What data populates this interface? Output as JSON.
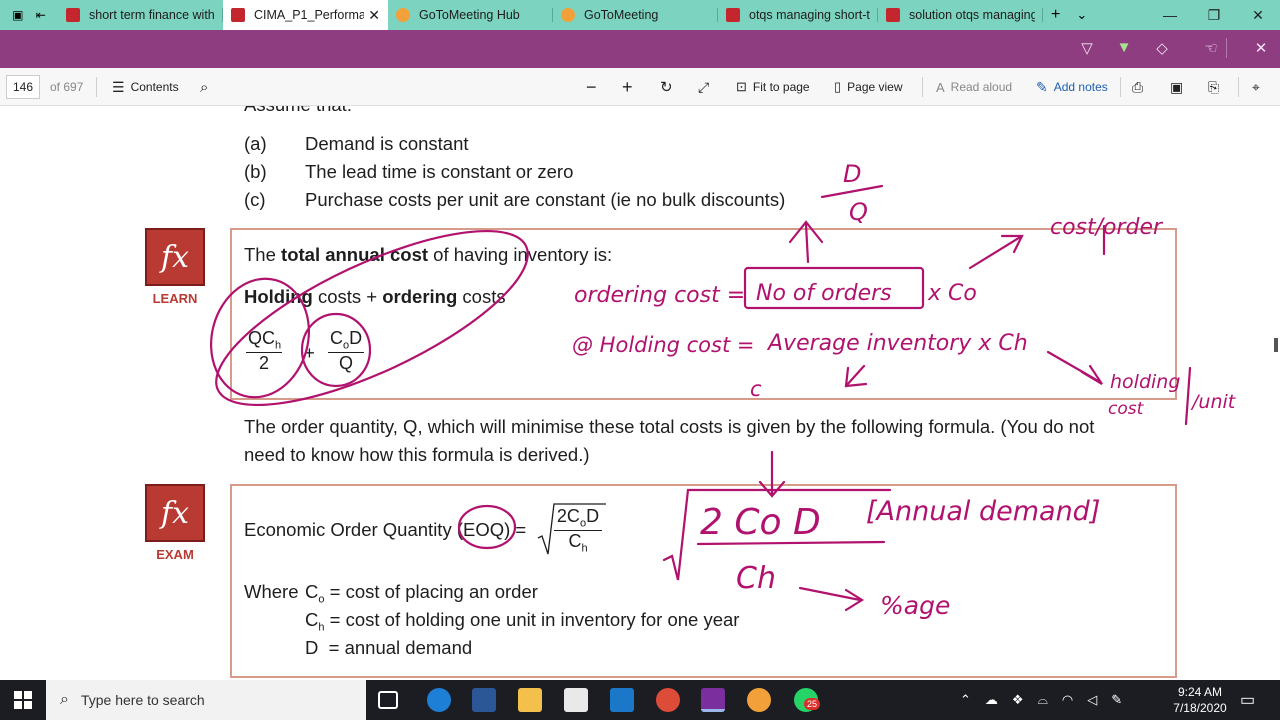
{
  "browser": {
    "tabs": [
      {
        "label": "short term finance with",
        "icon": "pdf-icon",
        "active": false
      },
      {
        "label": "CIMA_P1_Performa",
        "icon": "pdf-icon",
        "active": true
      },
      {
        "label": "GoToMeeting Hub",
        "icon": "gotomeeting-icon",
        "active": false
      },
      {
        "label": "GoToMeeting",
        "icon": "gotomeeting-icon",
        "active": false
      },
      {
        "label": "otqs managing short-te",
        "icon": "pdf-icon",
        "active": false
      },
      {
        "label": "solution otqs managing",
        "icon": "pdf-icon",
        "active": false
      }
    ],
    "close_glyph": "✕",
    "new_tab_glyph": "+",
    "tab_list_glyph": "⌄",
    "window_controls": [
      "—",
      "❐",
      "✕"
    ],
    "accent": "#7cd3bf"
  },
  "annotation_bar": {
    "color": "#8e3d80",
    "tools": [
      "highlight-icon",
      "text-highlight-icon",
      "eraser-icon",
      "touch-write-icon",
      "close-icon"
    ]
  },
  "pdf_toolbar": {
    "page_number": "146",
    "page_total": "of 697",
    "contents_label": "Contents",
    "fit_to_page_label": "Fit to page",
    "page_view_label": "Page view",
    "read_aloud_label": "Read aloud",
    "add_notes_label": "Add notes"
  },
  "document": {
    "partial_heading": "Assume that:",
    "assumptions": [
      {
        "marker": "(a)",
        "text": "Demand is constant"
      },
      {
        "marker": "(b)",
        "text": "The lead time is constant or zero"
      },
      {
        "marker": "(c)",
        "text": "Purchase costs per unit are constant (ie no bulk discounts)"
      }
    ],
    "learn_box": {
      "badge": "fx",
      "caption": "LEARN",
      "sentence_pre": "The ",
      "sentence_bold": "total annual cost",
      "sentence_post": " of having inventory is:",
      "line2_bold1": "Holding",
      "line2_mid": " costs + ",
      "line2_bold2": "ordering",
      "line2_post": " costs",
      "frac1_num": "QC",
      "frac1_sub": "h",
      "frac1_den": "2",
      "plus": "+",
      "frac2_num": "C",
      "frac2_sub": "o",
      "frac2_num2": "D",
      "frac2_den": "Q"
    },
    "order_quantity_text_line1": "The order quantity, Q, which will minimise these total costs is given by the following formula. (You do not",
    "order_quantity_text_line2": "need to know how this formula is derived.)",
    "exam_box": {
      "badge": "fx",
      "caption": "EXAM",
      "eoq_label": "Economic Order Quantity (EOQ) =",
      "eoq_num": "2C",
      "eoq_num_sub": "o",
      "eoq_num2": "D",
      "eoq_den": "C",
      "eoq_den_sub": "h",
      "where_prefix": "Where",
      "definitions": [
        {
          "sym": "C",
          "sub": "o",
          "text": "= cost of placing an order"
        },
        {
          "sym": "C",
          "sub": "h",
          "text": "= cost of holding one unit in inventory for one year"
        },
        {
          "sym": "D",
          "sub": "",
          "text": "= annual demand"
        }
      ]
    }
  },
  "handwriting": {
    "ink_color": "#b0126e",
    "notes": {
      "d_over_q_num": "D",
      "d_over_q_den": "Q",
      "cost_order": "cost/order",
      "ordering_cost_lhs": "ordering cost =",
      "no_of_orders": "No of orders",
      "times_co": "x Co",
      "holding_cost_lhs": "@ Holding cost =",
      "avg_inventory": "Average inventory x Ch",
      "c_mark": "c",
      "holding_cost_unit_a": "holding",
      "holding_cost_unit_b": "cost",
      "holding_cost_unit_c": "/unit",
      "eoq_num": "2 Co D",
      "annual_demand": "[Annual demand]",
      "eoq_den": "Ch",
      "percentage": "%age"
    }
  },
  "taskbar": {
    "search_placeholder": "Type here to search",
    "time": "9:24 AM",
    "date": "7/18/2020",
    "badge_count": "25",
    "pinned": [
      "task-view-icon",
      "edge-icon",
      "word-icon",
      "file-explorer-icon",
      "store-icon",
      "mail-icon",
      "chrome-icon",
      "onenote-icon",
      "gotomeeting-icon",
      "whatsapp-icon"
    ]
  }
}
